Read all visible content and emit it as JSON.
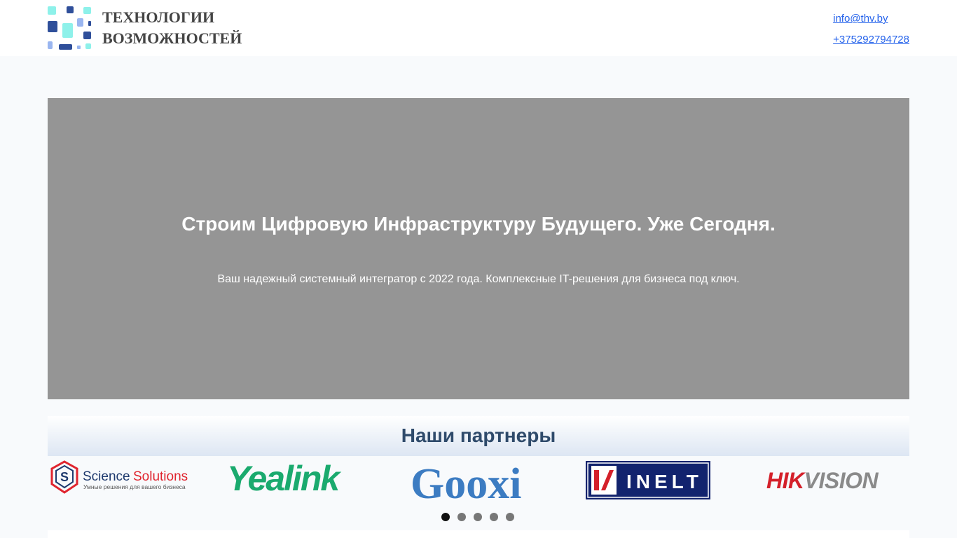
{
  "header": {
    "brand_line1": "ТЕХНОЛОГИИ",
    "brand_line2": "ВОЗМОЖНОСТЕЙ",
    "email": "info@thv.by",
    "phone": "+375292794728"
  },
  "hero": {
    "title": "Строим Цифровую Инфраструктуру Будущего. Уже Сегодня.",
    "subtitle": "Ваш надежный системный интегратор с 2022 года. Комплексные IT-решения для бизнеса под ключ."
  },
  "partners": {
    "title": "Наши партнеры",
    "logos": [
      {
        "name": "Science Solutions",
        "word1": "Science",
        "word2": "Solutions",
        "tagline": "Умные решения для вашего бизнеса"
      },
      {
        "name": "Yealink",
        "text": "Yealink"
      },
      {
        "name": "Gooxi",
        "text": "Gooxi"
      },
      {
        "name": "INELT",
        "text": "INELT"
      },
      {
        "name": "HIKVISION",
        "text1": "HIK",
        "text2": "VISION"
      }
    ],
    "carousel": {
      "total": 5,
      "active": 1
    }
  },
  "colors": {
    "link": "#2563eb",
    "hero_bg": "#959595",
    "partners_title": "#2f4b6b",
    "logo_teal": "#8ef1ea",
    "logo_navy": "#2f4f9a",
    "logo_light_blue": "#9ab6f0",
    "yealink_green": "#1aaa6e",
    "gooxi_blue": "#3c7cc2",
    "inelt_navy": "#12236e",
    "hikvision_red": "#d4202a",
    "hikvision_gray": "#8a8a8a",
    "science_red": "#e0242e",
    "science_navy": "#1f3a6e"
  }
}
